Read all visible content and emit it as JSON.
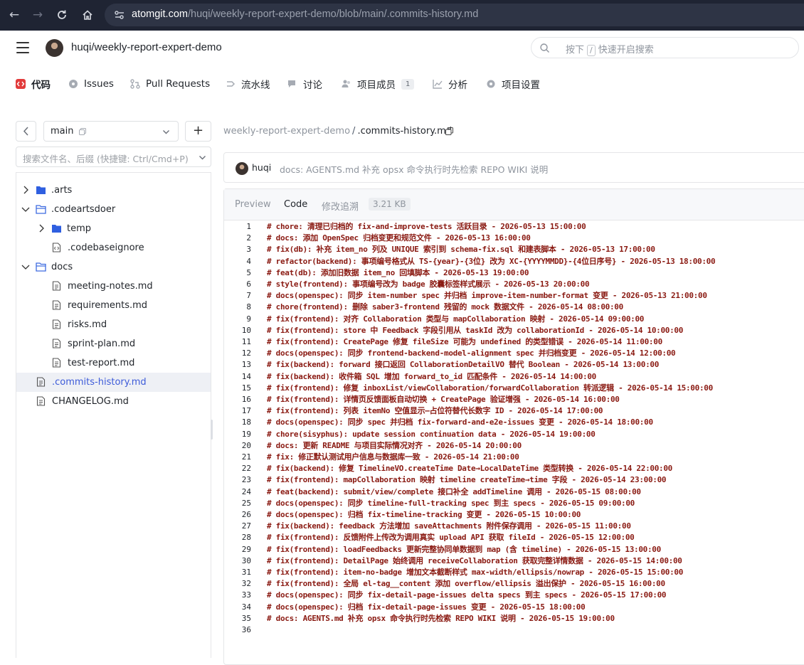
{
  "browser": {
    "url_host": "atomgit.com",
    "url_path": "/huqi/weekly-report-expert-demo/blob/main/.commits-history.md"
  },
  "header": {
    "owner": "huqi",
    "repo": "weekly-report-expert-demo",
    "search_prefix": "按下",
    "search_key": "/",
    "search_suffix": "快速开启搜索"
  },
  "tabs": [
    {
      "label": "代码",
      "icon": "code-icon"
    },
    {
      "label": "Issues",
      "icon": "issues-icon"
    },
    {
      "label": "Pull Requests",
      "icon": "pull-request-icon"
    },
    {
      "label": "流水线",
      "icon": "pipeline-icon"
    },
    {
      "label": "讨论",
      "icon": "discussion-icon"
    },
    {
      "label": "项目成员",
      "icon": "members-icon",
      "badge": "1"
    },
    {
      "label": "分析",
      "icon": "analytics-icon"
    },
    {
      "label": "项目设置",
      "icon": "settings-icon"
    }
  ],
  "sidebar": {
    "branch": "main",
    "add_label": "+",
    "search_placeholder": "搜索文件名、后缀 (快捷键: Ctrl/Cmd+P)",
    "tree": [
      {
        "label": ".arts",
        "type": "folder",
        "expanded": false
      },
      {
        "label": ".codeartsdoer",
        "type": "folder",
        "expanded": true
      },
      {
        "label": "temp",
        "type": "folder",
        "expanded": false
      },
      {
        "label": ".codebaseignore",
        "type": "file-code"
      },
      {
        "label": "docs",
        "type": "folder",
        "expanded": true
      },
      {
        "label": "meeting-notes.md",
        "type": "file"
      },
      {
        "label": "requirements.md",
        "type": "file"
      },
      {
        "label": "risks.md",
        "type": "file"
      },
      {
        "label": "sprint-plan.md",
        "type": "file"
      },
      {
        "label": "test-report.md",
        "type": "file"
      },
      {
        "label": ".commits-history.md",
        "type": "file",
        "selected": true
      },
      {
        "label": "CHANGELOG.md",
        "type": "file"
      }
    ]
  },
  "main": {
    "breadcrumb_repo": "weekly-report-expert-demo",
    "breadcrumb_sep": "/",
    "breadcrumb_file": ".commits-history.md",
    "commit_author": "huqi",
    "commit_message": "docs: AGENTS.md 补充 opsx 命令执行时先检索 REPO WIKI 说明",
    "file_tabs": [
      "Preview",
      "Code",
      "修改追溯"
    ],
    "active_file_tab": "Code",
    "file_size": "3.21 KB"
  },
  "code_lines": [
    "# chore: 清理已归档的 fix-and-improve-tests 活跃目录 - 2026-05-13 15:00:00",
    "# docs: 添加 OpenSpec 归档变更和规范文件 - 2026-05-13 16:00:00",
    "# fix(db): 补充 item_no 列及 UNIQUE 索引到 schema-fix.sql 和建表脚本 - 2026-05-13 17:00:00",
    "# refactor(backend): 事项编号格式从 TS-{year}-{3位} 改为 XC-{YYYYMMDD}-{4位日序号} - 2026-05-13 18:00:00",
    "# feat(db): 添加旧数据 item_no 回填脚本 - 2026-05-13 19:00:00",
    "# style(frontend): 事项编号改为 badge 胶囊标签样式展示 - 2026-05-13 20:00:00",
    "# docs(openspec): 同步 item-number spec 并归档 improve-item-number-format 变更 - 2026-05-13 21:00:00",
    "# chore(frontend): 删除 saber3-frontend 残留的 mock 数据文件 - 2026-05-14 08:00:00",
    "# fix(frontend): 对齐 Collaboration 类型与 mapCollaboration 映射 - 2026-05-14 09:00:00",
    "# fix(frontend): store 中 Feedback 字段引用从 taskId 改为 collaborationId - 2026-05-14 10:00:00",
    "# fix(frontend): CreatePage 修复 fileSize 可能为 undefined 的类型错误 - 2026-05-14 11:00:00",
    "# docs(openspec): 同步 frontend-backend-model-alignment spec 并归档变更 - 2026-05-14 12:00:00",
    "# fix(backend): forward 接口返回 CollaborationDetailVO 替代 Boolean - 2026-05-14 13:00:00",
    "# fix(backend): 收件箱 SQL 增加 forward_to_id 匹配条件 - 2026-05-14 14:00:00",
    "# fix(frontend): 修复 inboxList/viewCollaboration/forwardCollaboration 转派逻辑 - 2026-05-14 15:00:00",
    "# fix(frontend): 详情页反馈面板自动切换 + CreatePage 验证增强 - 2026-05-14 16:00:00",
    "# fix(frontend): 列表 itemNo 空值显示—占位符替代长数字 ID - 2026-05-14 17:00:00",
    "# docs(openspec): 同步 spec 并归档 fix-forward-and-e2e-issues 变更 - 2026-05-14 18:00:00",
    "# chore(sisyphus): update session continuation data - 2026-05-14 19:00:00",
    "# docs: 更新 README 与项目实际情况对齐 - 2026-05-14 20:00:00",
    "# fix: 修正默认测试用户信息与数据库一致 - 2026-05-14 21:00:00",
    "# fix(backend): 修复 TimelineVO.createTime Date→LocalDateTime 类型转换 - 2026-05-14 22:00:00",
    "# fix(frontend): mapCollaboration 映射 timeline createTime→time 字段 - 2026-05-14 23:00:00",
    "# feat(backend): submit/view/complete 接口补全 addTimeline 调用 - 2026-05-15 08:00:00",
    "# docs(openspec): 同步 timeline-full-tracking spec 到主 specs - 2026-05-15 09:00:00",
    "# docs(openspec): 归档 fix-timeline-tracking 变更 - 2026-05-15 10:00:00",
    "# fix(backend): feedback 方法增加 saveAttachments 附件保存调用 - 2026-05-15 11:00:00",
    "# fix(frontend): 反馈附件上传改为调用真实 upload API 获取 fileId - 2026-05-15 12:00:00",
    "# fix(frontend): loadFeedbacks 更新完整协同单数据到 map (含 timeline) - 2026-05-15 13:00:00",
    "# fix(frontend): DetailPage 始终调用 receiveCollaboration 获取完整详情数据 - 2026-05-15 14:00:00",
    "# fix(frontend): item-no-badge 增加文本截断样式 max-width/ellipsis/nowrap - 2026-05-15 15:00:00",
    "# fix(frontend): 全局 el-tag__content 添加 overflow/ellipsis 溢出保护 - 2026-05-15 16:00:00",
    "# docs(openspec): 同步 fix-detail-page-issues delta specs 到主 specs - 2026-05-15 17:00:00",
    "# docs(openspec): 归档 fix-detail-page-issues 变更 - 2026-05-15 18:00:00",
    "# docs: AGENTS.md 补充 opsx 命令执行时先检索 REPO WIKI 说明 - 2026-05-15 19:00:00",
    ""
  ]
}
